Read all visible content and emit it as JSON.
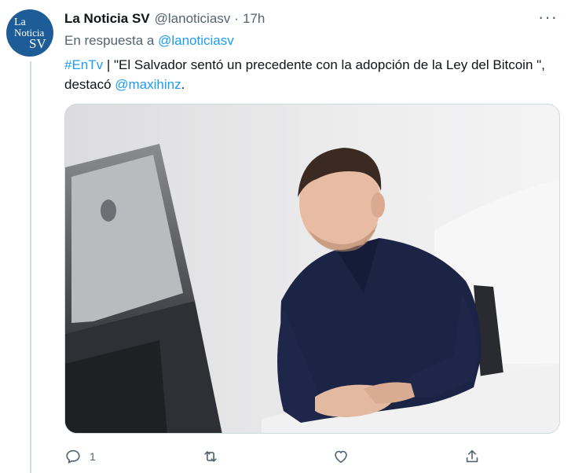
{
  "tweet": {
    "display_name": "La Noticia SV",
    "handle": "@lanoticiasv",
    "separator": "·",
    "time": "17h",
    "avatar_lines": [
      "La",
      "Noticia",
      "SV"
    ],
    "reply_prefix": "En respuesta a",
    "reply_to": "@lanoticiasv",
    "hashtag": "#EnTv",
    "text_1": " | \"El Salvador sentó un precedente con la adopción de la Ley del Bitcoin \", destacó ",
    "mention": "@maxihinz",
    "text_2": "."
  },
  "actions": {
    "reply_count": "1",
    "retweet_count": "",
    "like_count": ""
  },
  "icons": {
    "more": "more-horizontal-icon",
    "reply": "reply-icon",
    "retweet": "retweet-icon",
    "like": "heart-icon",
    "share": "share-icon"
  },
  "colors": {
    "link": "#1d9bf0",
    "avatar_bg": "#1d5c96",
    "muted": "#536471"
  }
}
